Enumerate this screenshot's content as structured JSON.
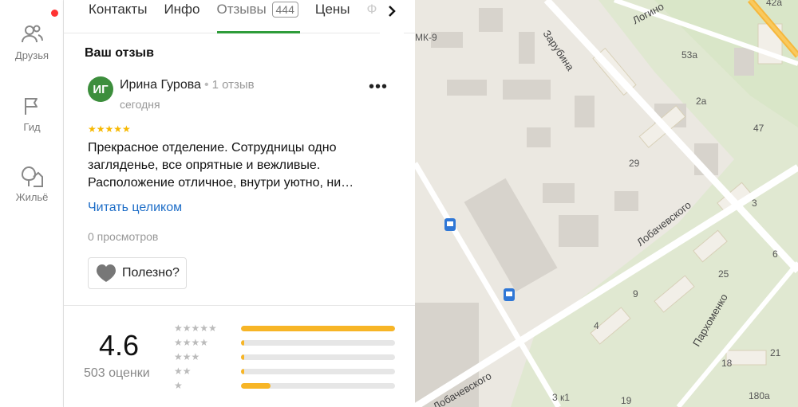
{
  "rail": {
    "friends": "Друзья",
    "guide": "Гид",
    "housing": "Жильё"
  },
  "tabs": {
    "contacts": "Контакты",
    "info": "Инфо",
    "reviews": "Отзывы",
    "reviews_count": "444",
    "prices": "Цены",
    "next_faded": "Ф"
  },
  "review": {
    "section_title": "Ваш отзыв",
    "avatar_initials": "ИГ",
    "author_name": "Ирина Гурова",
    "author_reviews": "1 отзыв",
    "date": "сегодня",
    "stars": "★★★★★",
    "rating": 5,
    "text": "Прекрасное отделение. Сотрудницы одно загляденье, все опрятные и вежливые. Расположение отличное, внутри уютно, ни…",
    "read_more": "Читать целиком",
    "views": "0 просмотров",
    "useful_label": "Полезно?"
  },
  "summary": {
    "rating": "4.6",
    "ratings_count": "503 оценки",
    "distribution": [
      {
        "stars": 5,
        "label": "★★★★★",
        "fraction": 1.0
      },
      {
        "stars": 4,
        "label": "★★★★",
        "fraction": 0.02
      },
      {
        "stars": 3,
        "label": "★★★",
        "fraction": 0.02
      },
      {
        "stars": 2,
        "label": "★★",
        "fraction": 0.02
      },
      {
        "stars": 1,
        "label": "★",
        "fraction": 0.19
      }
    ]
  },
  "map": {
    "labels": {
      "mk9": "МК-9",
      "n42a": "42а",
      "n53a": "53а",
      "n2a": "2а",
      "n47": "47",
      "n29": "29",
      "n3": "3",
      "n6": "6",
      "n25": "25",
      "n9": "9",
      "n4": "4",
      "n21": "21",
      "n18": "18",
      "n19": "19",
      "n180a": "180а",
      "n3k1": "3 к1"
    },
    "streets": {
      "zarubina": "Зарубина",
      "logvinov": "Логино",
      "lobachevskogo_1": "Лобачевского",
      "lobachevskogo_2": "Лобачевского",
      "parkhomenko": "Пархоменко"
    }
  },
  "colors": {
    "accent_green": "#2e9c3a",
    "link_blue": "#1d6dc7",
    "star_yellow": "#f7b800",
    "notification_red": "#ff3333"
  }
}
